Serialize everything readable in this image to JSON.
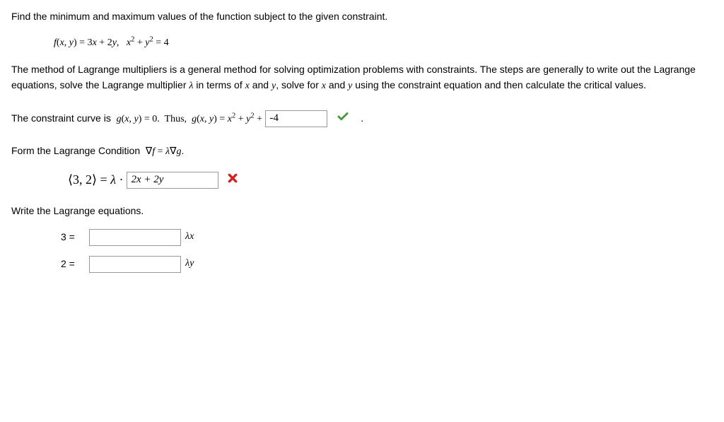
{
  "problem": {
    "instruction": "Find the minimum and maximum values of the function subject to the given constraint.",
    "function_def": "f(x, y) = 3x + 2y,   x² + y² = 4"
  },
  "explanation": {
    "line1": "The method of Lagrange multipliers is a general method for solving optimization problems with constraints. The steps are generally to write out the Lagrange equations, solve the Lagrange multiplier λ in terms of x and y, solve for x and y using the constraint equation and then calculate the critical values."
  },
  "constraint": {
    "prefix": "The constraint curve is  ",
    "eq1": "g(x, y) = 0.  Thus,  g(x, y) = x² + y² + ",
    "input_value": "-4",
    "suffix": "."
  },
  "lagrange_condition": {
    "heading": "Form the Lagrange Condition  ∇f = λ∇g.",
    "lhs_tuple": "⟨3, 2⟩ = λ · ",
    "input_value": "2x + 2y"
  },
  "lagrange_equations": {
    "heading": "Write the Lagrange equations.",
    "row1_lhs": "3 =",
    "row1_input": "",
    "row1_rhs": "λx",
    "row2_lhs": "2 =",
    "row2_input": "",
    "row2_rhs": "λy"
  }
}
